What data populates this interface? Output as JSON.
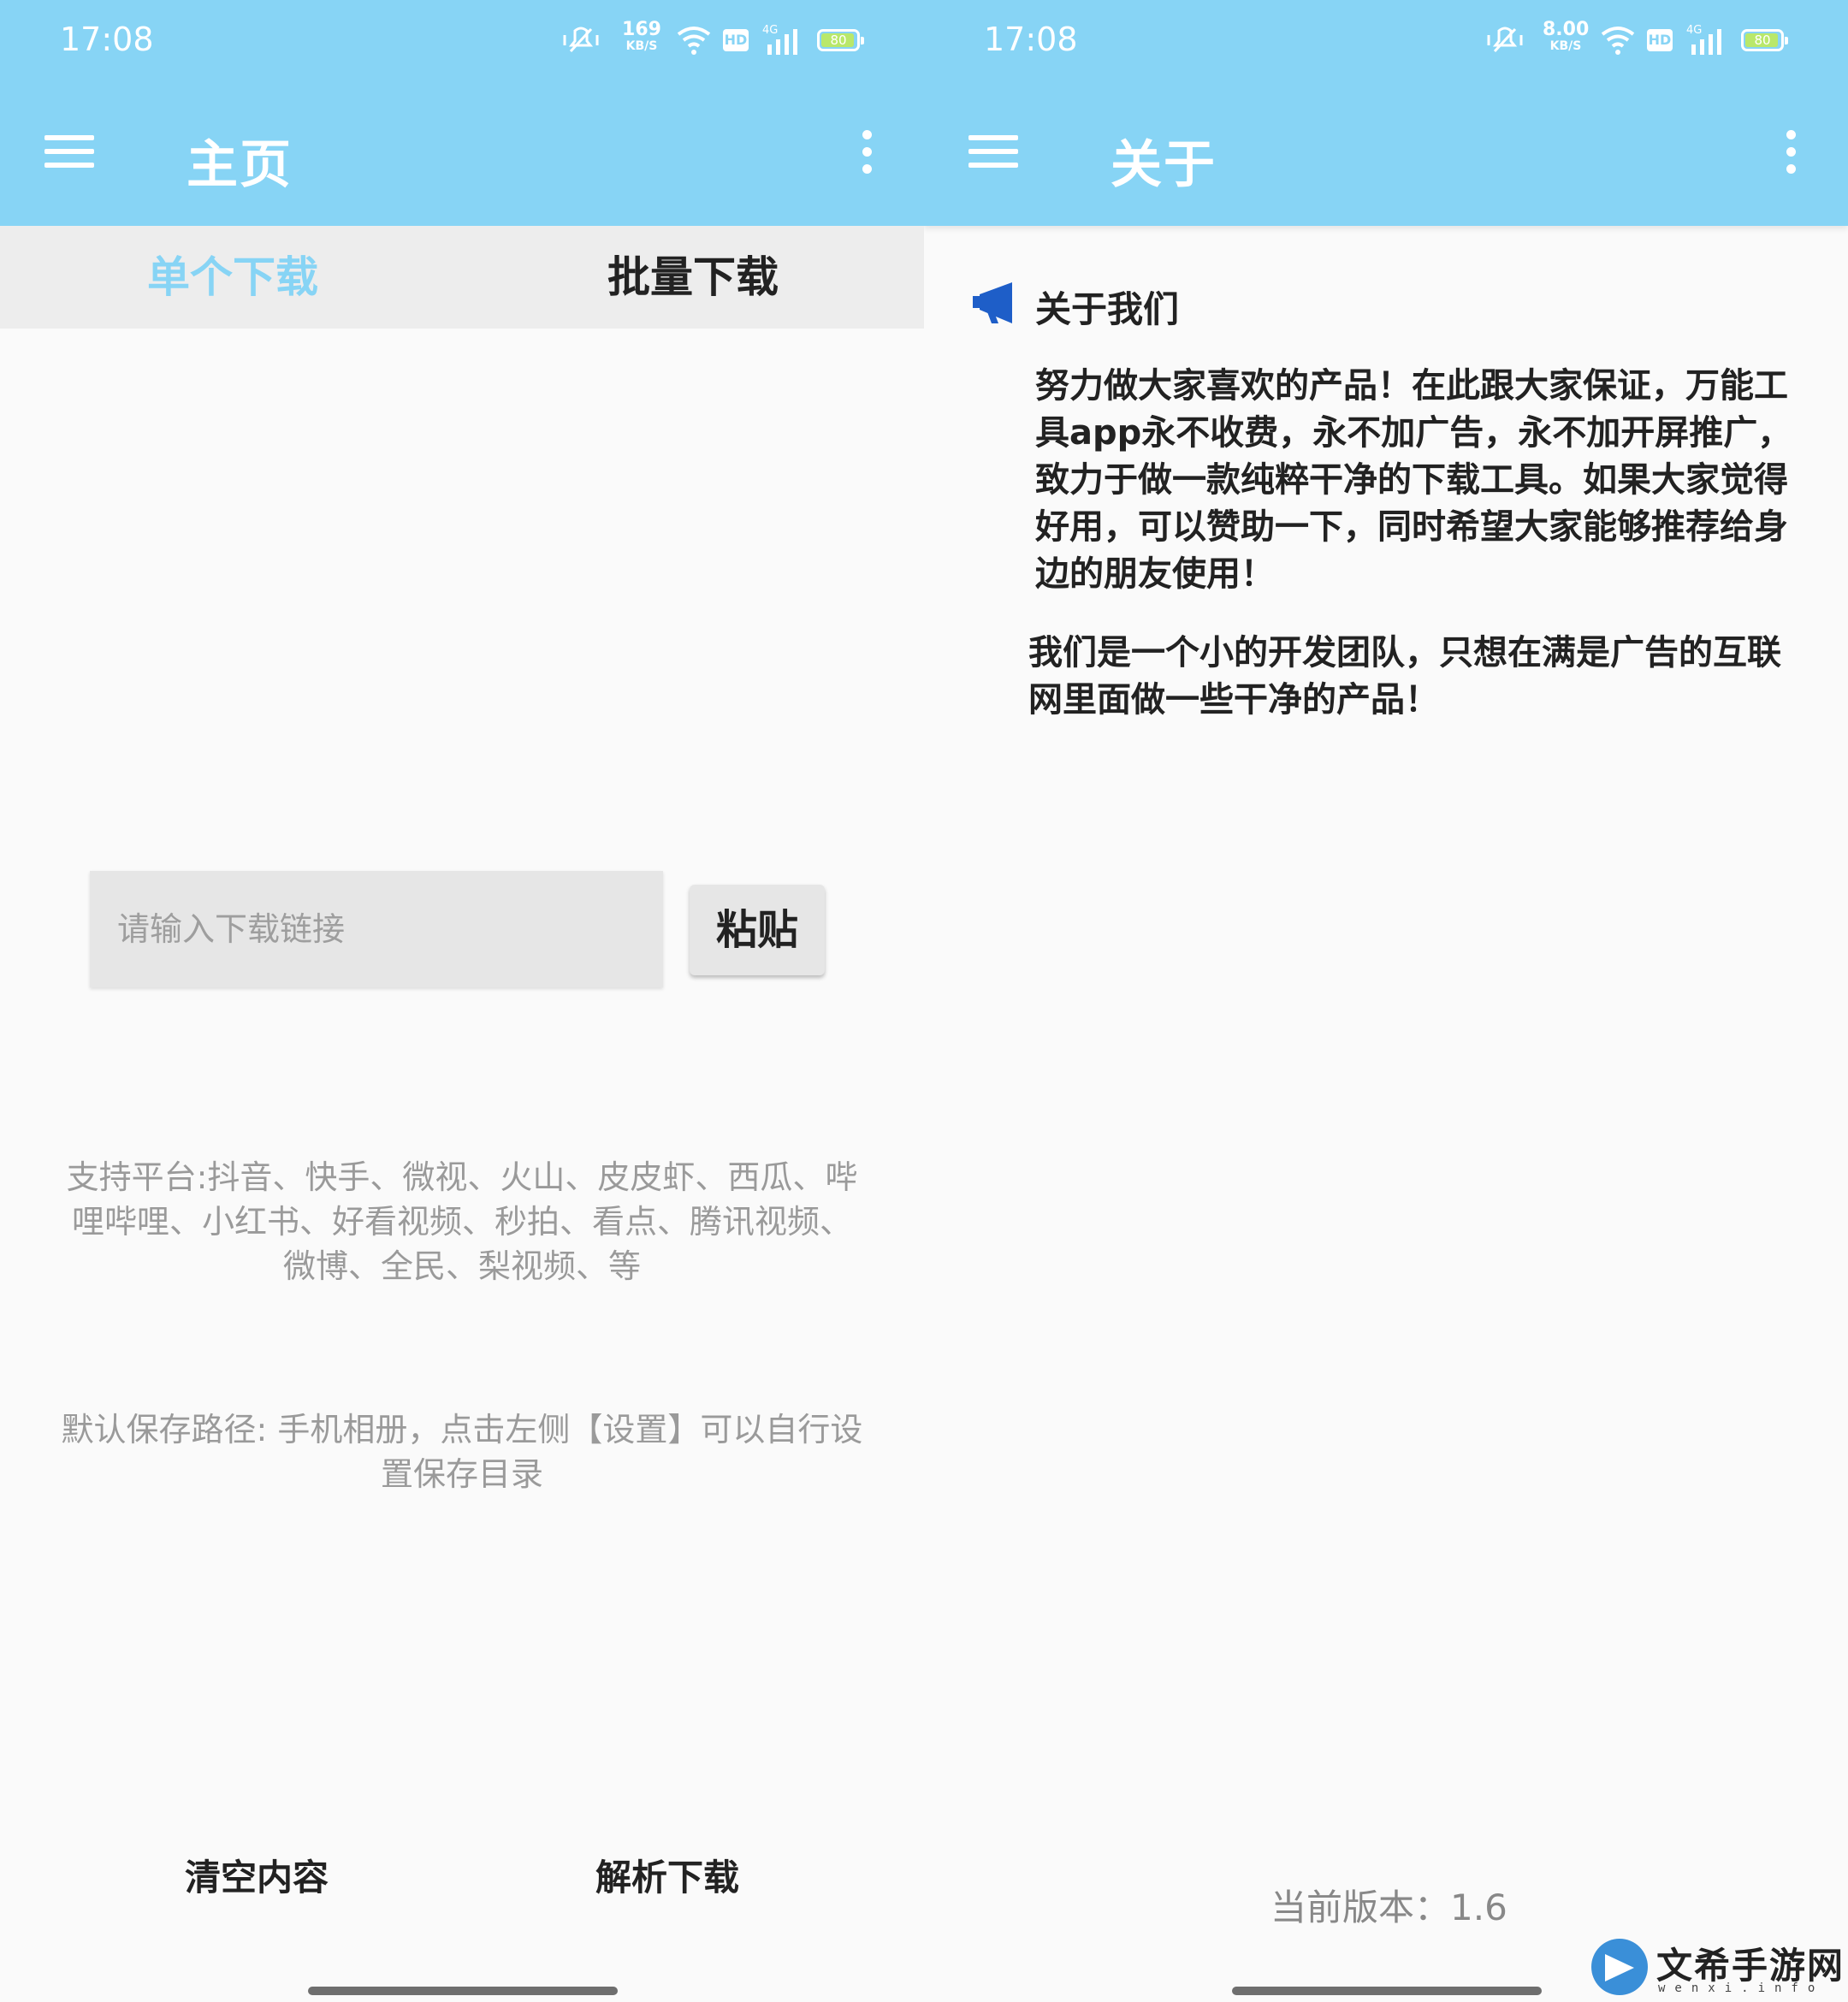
{
  "colors": {
    "accent": "#87d4f5",
    "tab_bar_bg": "#ededed",
    "page_bg": "#fafafa",
    "hint_text": "#9a9a9a",
    "megaphone": "#1e5ec8",
    "battery_fill": "#b9e86a"
  },
  "left": {
    "status": {
      "time": "17:08",
      "net_speed": "169",
      "net_unit": "KB/S",
      "hd": "HD",
      "signal": "4G",
      "battery": "80"
    },
    "appbar": {
      "title": "主页",
      "menu_icon": "hamburger-menu-icon",
      "more_icon": "more-vert-icon"
    },
    "tabs": [
      {
        "label": "单个下载",
        "selected": true
      },
      {
        "label": "批量下载",
        "selected": false
      }
    ],
    "input": {
      "placeholder": "请输入下载链接",
      "value": ""
    },
    "paste_label": "粘贴",
    "platforms_text": "支持平台:抖音、快手、微视、火山、皮皮虾、西瓜、哔哩哔哩、小红书、好看视频、秒拍、看点、腾讯视频、微博、全民、梨视频、等",
    "save_path_text": "默认保存路径: 手机相册，点击左侧【设置】可以自行设置保存目录",
    "buttons": {
      "clear": "清空内容",
      "parse": "解析下载"
    }
  },
  "right": {
    "status": {
      "time": "17:08",
      "net_speed": "8.00",
      "net_unit": "KB/S",
      "hd": "HD",
      "signal": "4G",
      "battery": "80"
    },
    "appbar": {
      "title": "关于",
      "menu_icon": "hamburger-menu-icon",
      "more_icon": "more-vert-icon"
    },
    "about": {
      "icon": "megaphone-icon",
      "title": "关于我们",
      "p1": "努力做大家喜欢的产品！在此跟大家保证，万能工具app永不收费，永不加广告，永不加开屏推广，致力于做一款纯粹干净的下载工具。如果大家觉得好用，可以赞助一下，同时希望大家能够推荐给身边的朋友使用！",
      "p2": "我们是一个小的开发团队，只想在满是广告的互联网里面做一些干净的产品！"
    },
    "version_text": "当前版本：1.6"
  },
  "watermark": {
    "text": "文希手游网",
    "sub": "wenxi.info"
  }
}
